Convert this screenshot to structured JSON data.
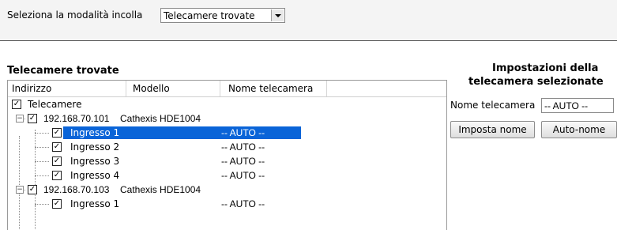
{
  "paste_mode": {
    "label": "Seleziona la modalità incolla",
    "selected": "Telecamere trovate"
  },
  "found_cameras": {
    "title": "Telecamere trovate",
    "columns": [
      "Indirizzo",
      "Modello",
      "Nome telecamera"
    ],
    "root_label": "Telecamere",
    "devices": [
      {
        "ip": "192.168.70.101",
        "model": "Cathexis HDE1004",
        "inputs": [
          {
            "name": "Ingresso 1",
            "camera_name": "-- AUTO --",
            "selected": true
          },
          {
            "name": "Ingresso 2",
            "camera_name": "-- AUTO --",
            "selected": false
          },
          {
            "name": "Ingresso 3",
            "camera_name": "-- AUTO --",
            "selected": false
          },
          {
            "name": "Ingresso 4",
            "camera_name": "-- AUTO --",
            "selected": false
          }
        ]
      },
      {
        "ip": "192.168.70.103",
        "model": "Cathexis HDE1004",
        "inputs": [
          {
            "name": "Ingresso 1",
            "camera_name": "-- AUTO --",
            "selected": false
          }
        ]
      }
    ]
  },
  "settings": {
    "title_line1": "Impostazioni della",
    "title_line2": "telecamera selezionate",
    "name_label": "Nome telecamera",
    "name_value": "-- AUTO --",
    "set_name_button": "Imposta nome",
    "auto_name_button": "Auto-nome"
  },
  "colors": {
    "selection": "#0a64d8",
    "top_panel": "#f4f4f4"
  }
}
